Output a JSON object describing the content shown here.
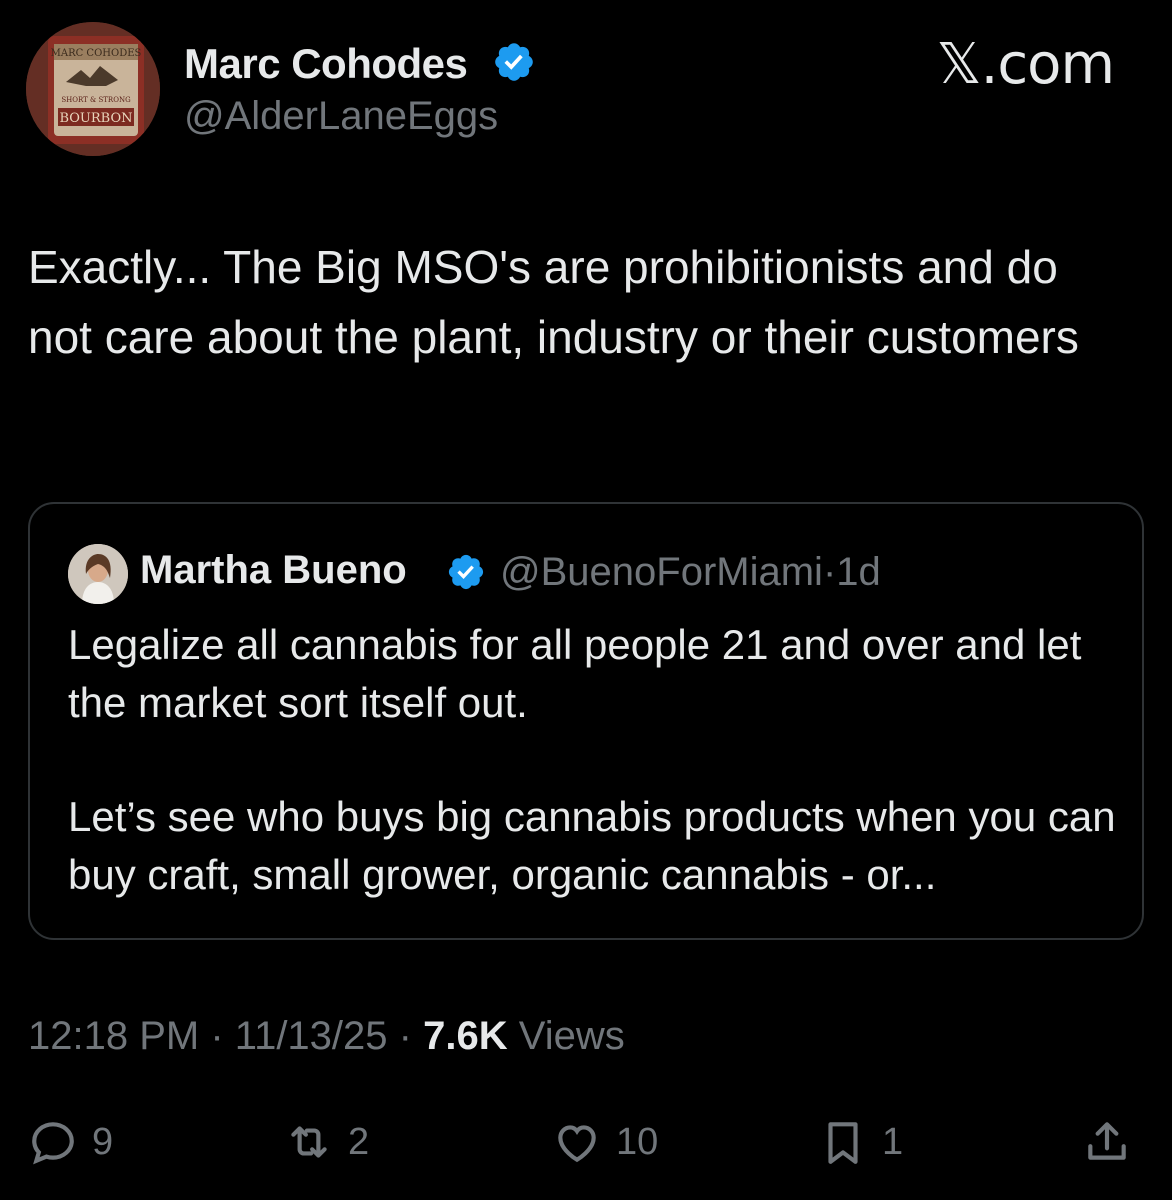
{
  "author": {
    "name": "Marc Cohodes",
    "handle": "@AlderLaneEggs"
  },
  "avatar_label": {
    "line1": "MARC COHODES",
    "line2": "SHORT & STRONG",
    "line3": "BOURBON"
  },
  "brand": "𝕏.com",
  "tweet": {
    "text": "Exactly... The Big MSO's are prohibitionists and do not care about the plant, industry or their customers"
  },
  "quote": {
    "name": "Martha Bueno",
    "handle": "@BuenoForMiami",
    "separator": "·",
    "time": "1d",
    "paragraph1": "Legalize all cannabis for all people 21 and over and let the market sort itself out.",
    "paragraph2": "Let’s see who buys big cannabis products when you can buy craft, small grower, organic cannabis - or..."
  },
  "meta": {
    "time": "12:18 PM",
    "date": "11/13/25",
    "separator": "·",
    "views_count": "7.6K",
    "views_label": "Views"
  },
  "actions": {
    "replies": "9",
    "reposts": "2",
    "likes": "10",
    "bookmarks": "1"
  },
  "colors": {
    "background": "#000000",
    "text": "#e7e9ea",
    "muted": "#71767b",
    "verified": "#1d9bf0",
    "border": "#2f3336"
  },
  "icons": [
    "verified-badge-icon",
    "reply-icon",
    "repost-icon",
    "like-icon",
    "bookmark-icon",
    "share-icon"
  ]
}
